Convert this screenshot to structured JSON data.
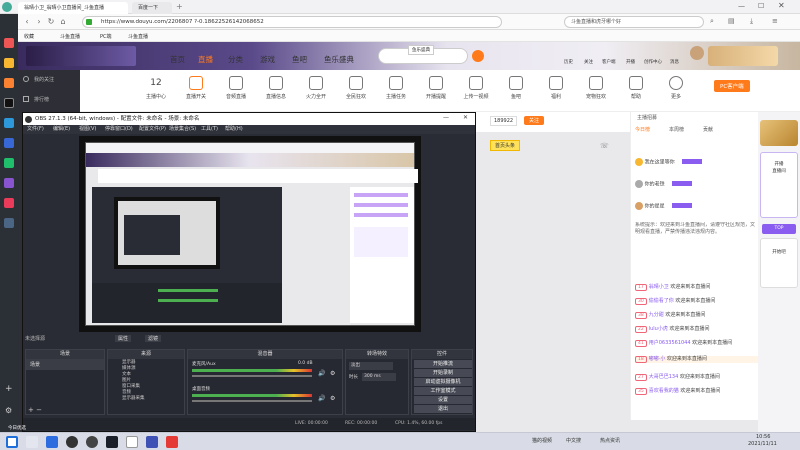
{
  "browser": {
    "tabs": [
      "翁晴小卫_翁晴小卫直播间_斗鱼直播",
      "百度一下"
    ],
    "url": "https://www.douyu.com/2206807 ?-0.18622526142068652",
    "search": "斗鱼直播和虎牙哪个好",
    "bookmarks": [
      "收藏",
      "斗鱼直播",
      "PC端",
      "斗鱼直播"
    ],
    "right_icons": [
      "更多"
    ]
  },
  "douyu": {
    "nav": [
      "首页",
      "直播",
      "分类",
      "游戏",
      "鱼吧",
      "鱼乐盛典"
    ],
    "nav_active": 1,
    "login_badge": "鱼乐盛典",
    "user_icons": [
      "历史",
      "关注",
      "客户端",
      "开播",
      "创作中心",
      "消息",
      "我的"
    ],
    "sidebar": [
      "我的关注",
      "排行榜"
    ],
    "categories": [
      {
        "label": "主播中心",
        "num": "12"
      },
      {
        "label": "直播开关"
      },
      {
        "label": "音频直播"
      },
      {
        "label": "直播信息"
      },
      {
        "label": "火力全开"
      },
      {
        "label": "全民狂欢"
      },
      {
        "label": "主播任务"
      },
      {
        "label": "开播提醒"
      },
      {
        "label": "上传一视频"
      },
      {
        "label": "鱼吧"
      },
      {
        "label": "福利"
      },
      {
        "label": "宠物狂欢"
      },
      {
        "label": "帮助"
      },
      {
        "label": "更多"
      }
    ],
    "pc_tag": "PC客户端",
    "room_actions": {
      "follow": "关注",
      "fans": "189922",
      "badge": "首页头条"
    },
    "chat_tabs": [
      "今日榜",
      "本周榜",
      "贡献"
    ],
    "chat_header": "主播招募",
    "chat_rank": [
      {
        "name": "我在这里等你",
        "value": ""
      },
      {
        "name": "你的老铁",
        "value": ""
      },
      {
        "name": "你的星星",
        "value": ""
      }
    ],
    "system_msg": "系统提示：欢迎来到斗鱼直播间，请遵守社区规范，文明观看直播，严禁传播违法违规内容。",
    "chat_msgs": [
      {
        "lvl": "17",
        "name": "翁晴小卫",
        "text": "欢迎来到本直播间"
      },
      {
        "lvl": "30",
        "name": "偷偷看了你",
        "text": "欢迎来到本直播间"
      },
      {
        "lvl": "38",
        "name": "九分甜",
        "text": "欢迎来到本直播间"
      },
      {
        "lvl": "22",
        "name": "lulu小虎",
        "text": "欢迎来到本直播间"
      },
      {
        "lvl": "41",
        "name": "用户0633561044",
        "text": "欢迎来到本直播间"
      },
      {
        "lvl": "18",
        "name": "嘟嘟·小",
        "text": "欢迎来到本直播间"
      },
      {
        "lvl": "27",
        "name": "大哥巴巴134",
        "text": "欢迎来到本直播间"
      },
      {
        "lvl": "35",
        "name": "喜欢看我的猫",
        "text": "欢迎来到本直播间"
      }
    ],
    "ad_text": [
      "开播",
      "直播间",
      "TOP",
      "开始吧"
    ]
  },
  "obs": {
    "title": "OBS 27.1.3 (64-bit, windows) - 配置文件: 未命名 - 场景: 未命名",
    "menu": [
      "文件(F)",
      "编辑(E)",
      "视图(V)",
      "停靠窗口(D)",
      "配置文件(P)",
      "场景集合(S)",
      "工具(T)",
      "帮助(H)"
    ],
    "panels": {
      "scenes": "场景",
      "sources": "来源",
      "mixer": "混音器",
      "transitions": "转场特效",
      "controls": "控件"
    },
    "scene_item": "场景",
    "source_items": [
      "显示器",
      "媒体源",
      "文本",
      "图片",
      "窗口采集",
      "音频",
      "显示器采集"
    ],
    "mixer_tracks": [
      {
        "name": "桌面音频",
        "db": "0.0 dB"
      },
      {
        "name": "麦克风/Aux",
        "db": "0.0 dB"
      }
    ],
    "transition": "淡出",
    "duration_label": "时长",
    "duration": "300 ms",
    "controls": [
      "开始推流",
      "开始录制",
      "启动虚拟摄像机",
      "工作室模式",
      "设置",
      "退出"
    ],
    "no_source": "未选择源",
    "props": "属性",
    "filters": "滤镜",
    "status": [
      "LIVE: 00:00:00",
      "REC: 00:00:00",
      "CPU: 1.4%, 60.00 fps"
    ]
  },
  "taskbar": {
    "apps": [
      "开始",
      "搜索",
      "任务视图",
      "浏览器",
      "文件",
      "OBS",
      "斗鱼",
      "微信"
    ],
    "tray": [
      "猫的视频",
      "中文搜",
      "热点资讯"
    ],
    "time": "10:56",
    "date": "2021/11/11",
    "weather": "今日优选"
  },
  "colors": {
    "accent": "#ff7a1a",
    "obs_bg": "#2a2c35",
    "chat_bg": "#ffffff",
    "purple": "#8a5cf0"
  }
}
